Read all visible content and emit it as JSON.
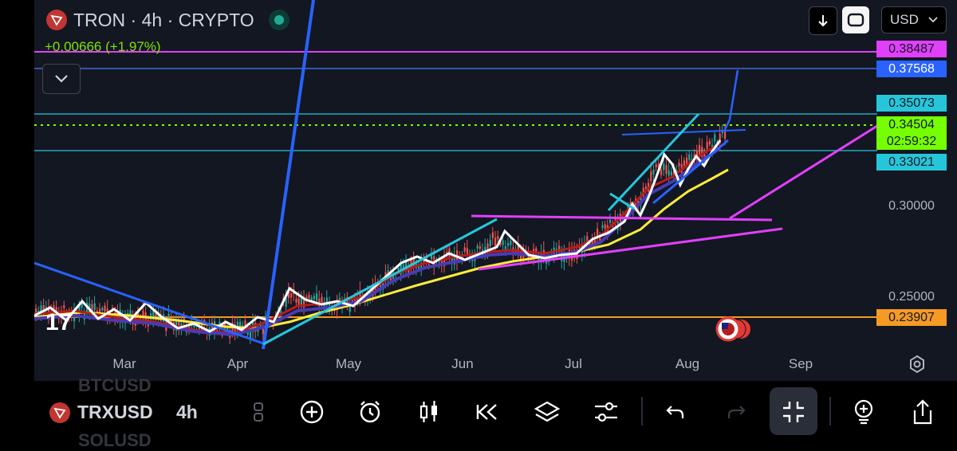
{
  "header": {
    "title": "TRON · 4h · CRYPTO",
    "change": "+0.00666 (+1.97%)",
    "currency": "USD"
  },
  "price_tags": [
    {
      "label": "0.38487",
      "bg": "#e040fb",
      "fg": "#131722"
    },
    {
      "label": "0.37568",
      "bg": "#2962ff",
      "fg": "#ffffff"
    },
    {
      "label": "0.35073",
      "bg": "#26c6da",
      "fg": "#131722"
    },
    {
      "label": "0.34504",
      "bg": "#76ff03",
      "fg": "#131722"
    },
    {
      "label": "02:59:32",
      "bg": "#76ff03",
      "fg": "#131722"
    },
    {
      "label": "0.33021",
      "bg": "#26c6da",
      "fg": "#131722"
    },
    {
      "label": "0.23907",
      "bg": "#f59a23",
      "fg": "#131722"
    }
  ],
  "price_axis": [
    "0.30000",
    "0.25000"
  ],
  "time_axis": [
    "Mar",
    "Apr",
    "May",
    "Jun",
    "Jul",
    "Aug",
    "Sep"
  ],
  "toolbar": {
    "symbol": "TRXUSD",
    "timeframe": "4h",
    "ghost_above": "BTCUSD",
    "ghost_below": "SOLUSD",
    "icons": [
      "drag-handle-icon",
      "add-icon",
      "alarm-icon",
      "candles-icon",
      "replay-icon",
      "layers-icon",
      "settings-sliders-icon",
      "undo-icon",
      "redo-icon",
      "collapse-icon",
      "indicator-icon",
      "share-icon"
    ]
  },
  "colors": {
    "chart_bg": "#131722",
    "magenta": "#e040fb",
    "blue": "#2962ff",
    "cyan": "#26c6da",
    "lime": "#76ff03",
    "orange": "#f59a23"
  }
}
